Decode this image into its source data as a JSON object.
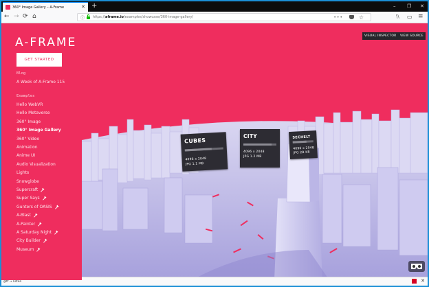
{
  "browser": {
    "tab_title": "360° Image Gallery – A-Frame",
    "tab_close": "✕",
    "new_tab": "+",
    "win_minimize": "–",
    "win_restore": "❐",
    "win_close": "✕",
    "back": "←",
    "forward": "→",
    "refresh": "⟳",
    "home": "⌂",
    "url_host": "aframe.io",
    "url_prefix": "https://",
    "url_path": "/examples/showcase/360-image-gallery/",
    "url_more": "•••",
    "bookmark_star": "☆",
    "library_icon": "\\\\",
    "sidebar_icon": "▭",
    "menu_icon": "≡",
    "status_text": "gltf → listen",
    "status_close": "✕"
  },
  "sidebar": {
    "logo": "A-FRAME",
    "get_started": "GET STARTED",
    "blog_heading": "Blog",
    "blog_items": [
      "A Week of A-Frame 115"
    ],
    "examples_heading": "Examples",
    "examples": [
      {
        "label": "Hello WebVR",
        "wrench": false
      },
      {
        "label": "Hello Metaverse",
        "wrench": false
      },
      {
        "label": "360° Image",
        "wrench": false
      },
      {
        "label": "360° Image Gallery",
        "wrench": false,
        "active": true
      },
      {
        "label": "360° Video",
        "wrench": false
      },
      {
        "label": "Animation",
        "wrench": false
      },
      {
        "label": "Anime UI",
        "wrench": false
      },
      {
        "label": "Audio Visualization",
        "wrench": false
      },
      {
        "label": "Lights",
        "wrench": false
      },
      {
        "label": "Snowglobe",
        "wrench": false
      },
      {
        "label": "Supercraft",
        "wrench": true
      },
      {
        "label": "Super Says",
        "wrench": true
      },
      {
        "label": "Gunters of OASIS",
        "wrench": true
      },
      {
        "label": "A-Blast",
        "wrench": true
      },
      {
        "label": "A-Painter",
        "wrench": true
      },
      {
        "label": "A Saturday Night",
        "wrench": true
      },
      {
        "label": "City Builder",
        "wrench": true
      },
      {
        "label": "Museum",
        "wrench": true
      }
    ]
  },
  "scene": {
    "visual_inspector": "VISUAL INSPECTOR",
    "view_source": "VIEW SOURCE",
    "cards": [
      {
        "title": "CUBES",
        "line1": "4096 x 2048",
        "line2": "JPG 1.1 MB",
        "progress": 0.7
      },
      {
        "title": "CITY",
        "line1": "4096 x 2048",
        "line2": "JPG 1.2 MB",
        "progress": 0.85
      },
      {
        "title": "SECHELT",
        "line1": "4096 x 2048",
        "line2": "JPG 2B KB",
        "progress": 0.65
      }
    ]
  },
  "colors": {
    "accent": "#ef2d5e",
    "panel": "#2d2c33",
    "sky": "#ef2d5e",
    "buildings": "#c8c6ec"
  }
}
